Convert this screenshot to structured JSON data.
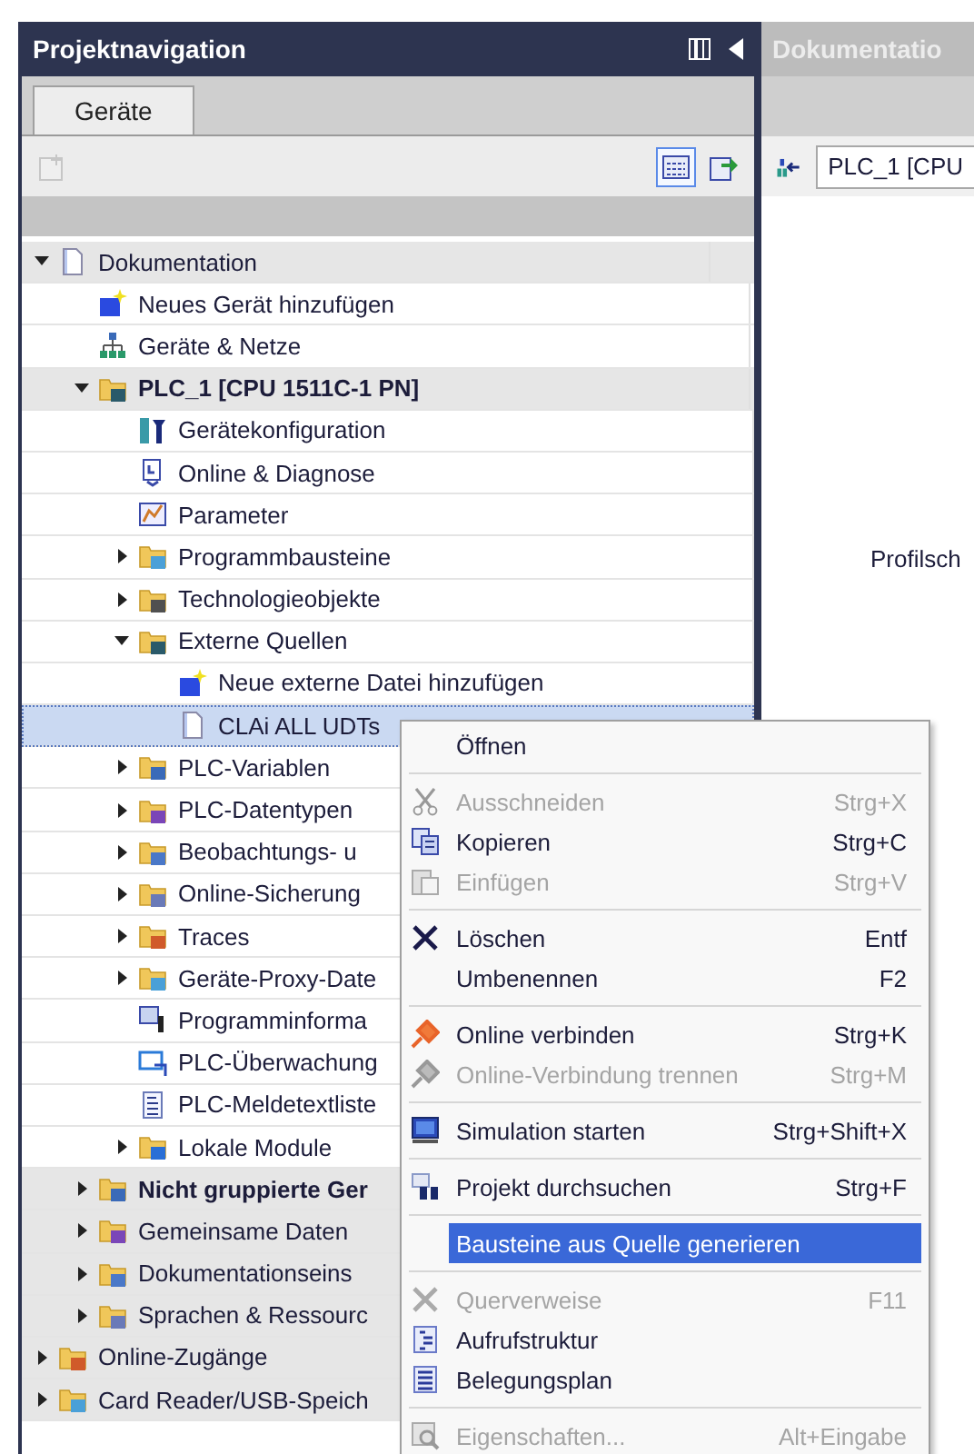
{
  "left_panel": {
    "title": "Projektnavigation",
    "tabs": [
      {
        "label": "Geräte",
        "selected": true
      }
    ],
    "toolbar_buttons": [
      {
        "disabled": true,
        "selected": false
      },
      {
        "disabled": false,
        "selected": true
      },
      {
        "disabled": false,
        "selected": false
      }
    ]
  },
  "tree": [
    {
      "label": "Dokumentation",
      "bold": false,
      "selected": false,
      "expanded": true,
      "children": [
        {
          "label": "Neues Gerät hinzufügen",
          "bold": false,
          "selected": false
        },
        {
          "label": "Geräte & Netze",
          "bold": false,
          "selected": false
        },
        {
          "label": "PLC_1 [CPU 1511C-1 PN]",
          "bold": true,
          "selected": false,
          "expanded": true,
          "children": [
            {
              "label": "Gerätekonfiguration",
              "bold": false,
              "selected": false
            },
            {
              "label": "Online & Diagnose",
              "bold": false,
              "selected": false
            },
            {
              "label": "Parameter",
              "bold": false,
              "selected": false
            },
            {
              "label": "Programmbausteine",
              "bold": false,
              "selected": false,
              "expanded": false
            },
            {
              "label": "Technologieobjekte",
              "bold": false,
              "selected": false,
              "expanded": false
            },
            {
              "label": "Externe Quellen",
              "bold": false,
              "selected": false,
              "expanded": true,
              "children": [
                {
                  "label": "Neue externe Datei hinzufügen",
                  "bold": false,
                  "selected": false
                },
                {
                  "label": "CLAi ALL UDTs",
                  "bold": false,
                  "selected": true
                }
              ]
            },
            {
              "label": "PLC-Variablen",
              "bold": false,
              "selected": false,
              "expanded": false
            },
            {
              "label": "PLC-Datentypen",
              "bold": false,
              "selected": false,
              "expanded": false
            },
            {
              "label": "Beobachtungs- u",
              "bold": false,
              "selected": false,
              "expanded": false
            },
            {
              "label": "Online-Sicherung",
              "bold": false,
              "selected": false,
              "expanded": false
            },
            {
              "label": "Traces",
              "bold": false,
              "selected": false,
              "expanded": false
            },
            {
              "label": "Geräte-Proxy-Date",
              "bold": false,
              "selected": false,
              "expanded": false
            },
            {
              "label": "Programminforma",
              "bold": false,
              "selected": false
            },
            {
              "label": "PLC-Überwachung",
              "bold": false,
              "selected": false
            },
            {
              "label": "PLC-Meldetextliste",
              "bold": false,
              "selected": false
            },
            {
              "label": "Lokale Module",
              "bold": false,
              "selected": false,
              "expanded": false
            }
          ]
        },
        {
          "label": "Nicht gruppierte Ger",
          "bold": true,
          "selected": false,
          "expanded": false
        },
        {
          "label": "Gemeinsame Daten",
          "bold": false,
          "selected": false,
          "expanded": false
        },
        {
          "label": "Dokumentationseins",
          "bold": false,
          "selected": false,
          "expanded": false
        },
        {
          "label": "Sprachen & Ressourc",
          "bold": false,
          "selected": false,
          "expanded": false
        }
      ]
    },
    {
      "label": "Online-Zugänge",
      "bold": false,
      "selected": false,
      "expanded": false
    },
    {
      "label": "Card Reader/USB-Speich",
      "bold": false,
      "selected": false,
      "expanded": false
    }
  ],
  "right_panel": {
    "title": "Dokumentatio",
    "device_field": {
      "value": "PLC_1 [CPU"
    },
    "content_text": "Profilsch"
  },
  "context_menu": [
    {
      "kind": "item",
      "label": "Öffnen",
      "disabled": false,
      "selected": false
    },
    {
      "kind": "separator"
    },
    {
      "kind": "item",
      "label": "Ausschneiden",
      "shortcut": "Strg+X",
      "disabled": true,
      "selected": false
    },
    {
      "kind": "item",
      "label": "Kopieren",
      "shortcut": "Strg+C",
      "disabled": false,
      "selected": false
    },
    {
      "kind": "item",
      "label": "Einfügen",
      "shortcut": "Strg+V",
      "disabled": true,
      "selected": false
    },
    {
      "kind": "separator"
    },
    {
      "kind": "item",
      "label": "Löschen",
      "shortcut": "Entf",
      "disabled": false,
      "selected": false
    },
    {
      "kind": "item",
      "label": "Umbenennen",
      "shortcut": "F2",
      "disabled": false,
      "selected": false
    },
    {
      "kind": "separator"
    },
    {
      "kind": "item",
      "label": "Online verbinden",
      "shortcut": "Strg+K",
      "disabled": false,
      "selected": false
    },
    {
      "kind": "item",
      "label": "Online-Verbindung trennen",
      "shortcut": "Strg+M",
      "disabled": true,
      "selected": false
    },
    {
      "kind": "separator"
    },
    {
      "kind": "item",
      "label": "Simulation starten",
      "shortcut": "Strg+Shift+X",
      "disabled": false,
      "selected": false
    },
    {
      "kind": "separator"
    },
    {
      "kind": "item",
      "label": "Projekt durchsuchen",
      "shortcut": "Strg+F",
      "disabled": false,
      "selected": false
    },
    {
      "kind": "separator"
    },
    {
      "kind": "item",
      "label": "Bausteine aus Quelle generieren",
      "disabled": false,
      "selected": true
    },
    {
      "kind": "separator"
    },
    {
      "kind": "item",
      "label": "Querverweise",
      "shortcut": "F11",
      "disabled": true,
      "selected": false
    },
    {
      "kind": "item",
      "label": "Aufrufstruktur",
      "disabled": false,
      "selected": false
    },
    {
      "kind": "item",
      "label": "Belegungsplan",
      "disabled": false,
      "selected": false
    },
    {
      "kind": "separator"
    },
    {
      "kind": "item",
      "label": "Eigenschaften...",
      "shortcut": "Alt+Eingabe",
      "disabled": true,
      "selected": false
    }
  ]
}
